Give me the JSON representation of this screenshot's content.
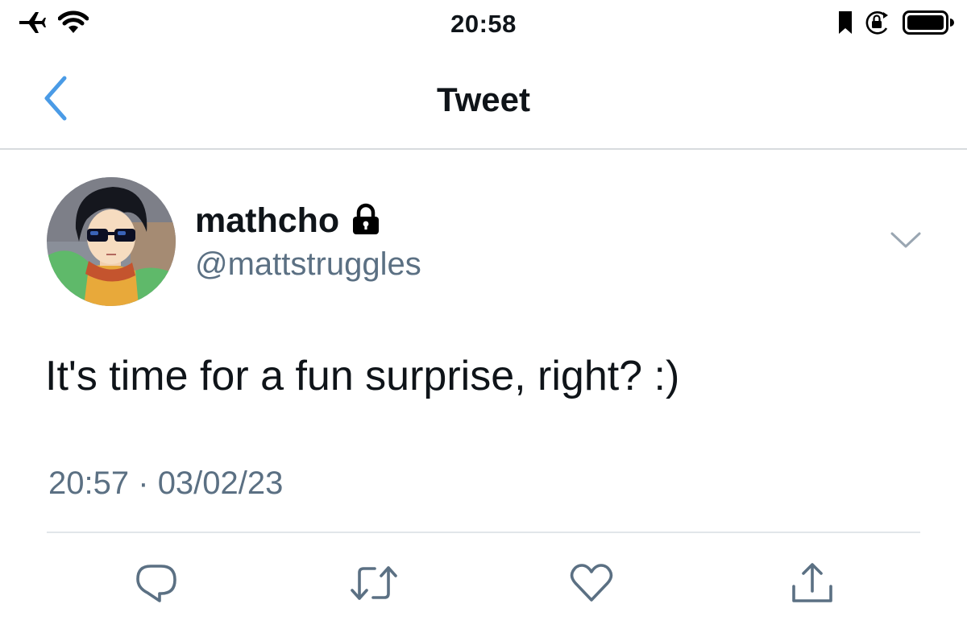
{
  "status_bar": {
    "time": "20:58",
    "icons_left": [
      "airplane-icon",
      "wifi-icon"
    ],
    "icons_right": [
      "bookmark-icon",
      "orientation-lock-icon",
      "battery-icon"
    ]
  },
  "nav": {
    "title": "Tweet",
    "back_icon": "chevron-left-icon"
  },
  "tweet": {
    "author": {
      "display_name": "mathcho",
      "handle": "@mattstruggles",
      "protected_icon": "lock-icon"
    },
    "text": "It's time for a fun surprise, right? :)",
    "time": "20:57",
    "separator": "·",
    "date": "03/02/23"
  },
  "actions": [
    {
      "name": "reply",
      "icon": "reply-icon"
    },
    {
      "name": "retweet",
      "icon": "retweet-icon"
    },
    {
      "name": "like",
      "icon": "heart-icon"
    },
    {
      "name": "share",
      "icon": "share-icon"
    }
  ],
  "colors": {
    "accent": "#4a9be6",
    "secondary_text": "#5b7083",
    "primary_text": "#0f1419",
    "divider": "#e1e6ea"
  }
}
